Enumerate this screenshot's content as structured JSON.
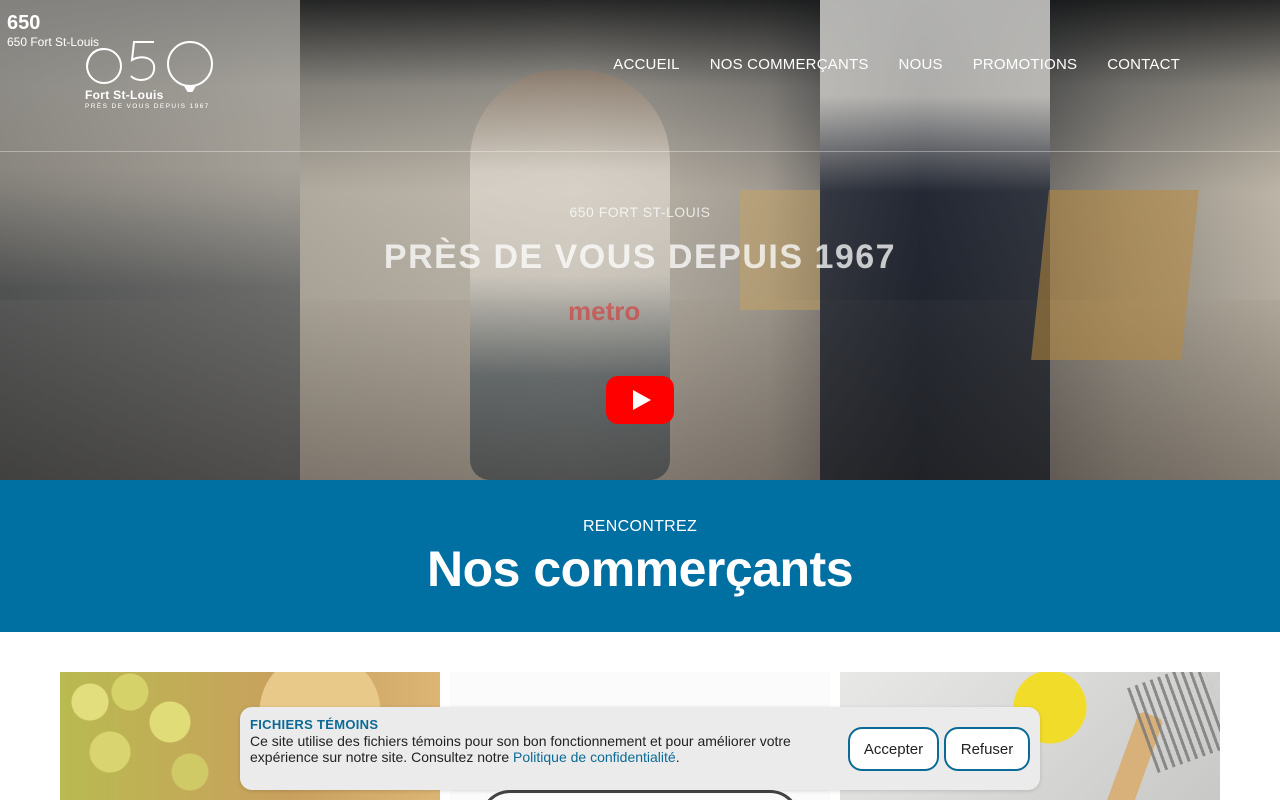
{
  "brand": {
    "corner_big": "650",
    "corner_small": "650 Fort St-Louis",
    "logo_name": "Fort St-Louis",
    "logo_tagline": "PRÈS DE VOUS DEPUIS 1967"
  },
  "nav": {
    "items": [
      "ACCUEIL",
      "NOS COMMERÇANTS",
      "NOUS",
      "PROMOTIONS",
      "CONTACT"
    ]
  },
  "hero": {
    "subtitle": "650 FORT ST-LOUIS",
    "title": "PRÈS DE VOUS DEPUIS 1967",
    "sign_text": "metro",
    "play_icon": "youtube-play-icon"
  },
  "section": {
    "kicker": "RENCONTREZ",
    "heading": "Nos commerçants",
    "color": "#006fa1"
  },
  "cookie": {
    "title": "FICHIERS TÉMOINS",
    "text": "Ce site utilise des fichiers témoins pour son bon fonctionnement et pour améliorer votre expérience sur notre site. Consultez notre ",
    "link": "Politique de confidentialité",
    "suffix": ".",
    "accept": "Accepter",
    "refuse": "Refuser"
  }
}
